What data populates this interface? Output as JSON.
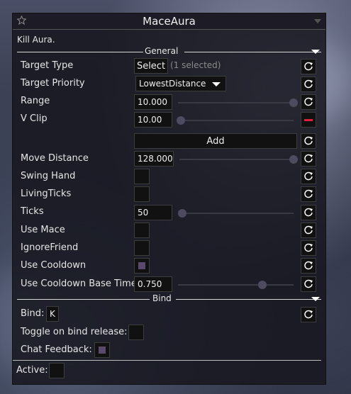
{
  "module": {
    "title": "MaceAura",
    "description": "Kill Aura."
  },
  "sections": {
    "general": "General",
    "bind": "Bind"
  },
  "settings": {
    "target_type": {
      "label": "Target Type",
      "button": "Select",
      "selected_text": "(1 selected)"
    },
    "target_priority": {
      "label": "Target Priority",
      "value": "LowestDistance"
    },
    "range": {
      "label": "Range",
      "value": "10.000",
      "level": 1.0
    },
    "v_clip": {
      "label": "V Clip",
      "value": "10.00",
      "level": 0.0
    },
    "add_button": "Add",
    "move_distance": {
      "label": "Move Distance",
      "value": "128.000",
      "level": 1.0
    },
    "swing_hand": {
      "label": "Swing Hand",
      "checked": false
    },
    "living_ticks": {
      "label": "LivingTicks",
      "checked": false
    },
    "ticks": {
      "label": "Ticks",
      "value": "50",
      "level": 0.0
    },
    "use_mace": {
      "label": "Use Mace",
      "checked": false
    },
    "ignore_friend": {
      "label": "IgnoreFriend",
      "checked": false
    },
    "use_cooldown": {
      "label": "Use Cooldown",
      "checked": true
    },
    "use_cooldown_base_time": {
      "label": "Use Cooldown Base Time",
      "value": "0.750",
      "level": 0.75
    }
  },
  "bind": {
    "bind_label": "Bind:",
    "bind_key": "K",
    "toggle_on_release_label": "Toggle on bind release:",
    "chat_feedback_label": "Chat Feedback:"
  },
  "active_label": "Active:",
  "icons": {
    "favorite": "star-icon",
    "reset": "reset-icon",
    "remove": "minus-icon",
    "collapse": "triangle-down-icon"
  },
  "colors": {
    "checkbox_fill": "#5a4a6e",
    "remove_red": "#e0203a",
    "slider_knob": "#4e4a60"
  }
}
